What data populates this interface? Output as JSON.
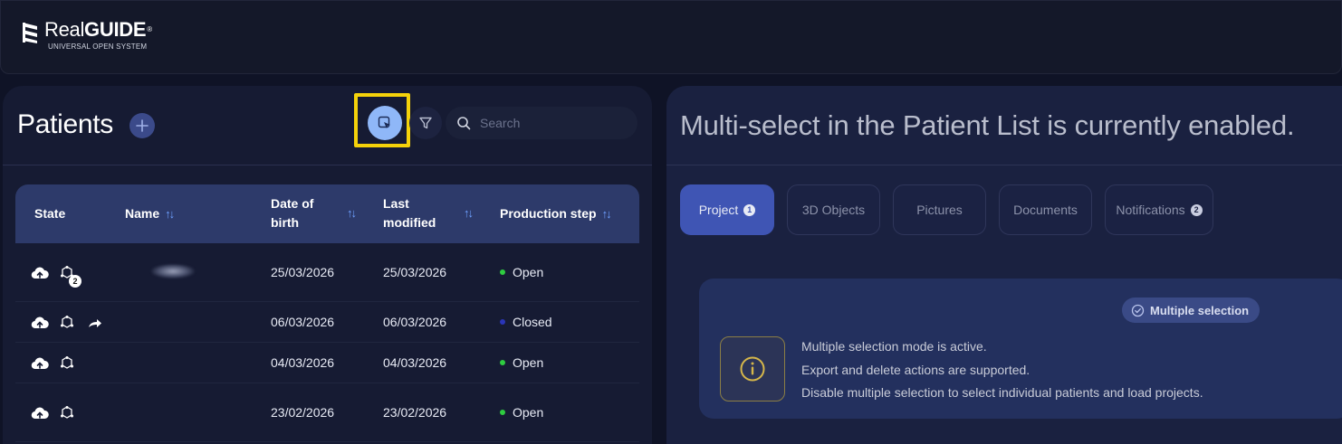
{
  "app": {
    "logo_title_regular": "Real",
    "logo_title_bold": "GUIDE",
    "logo_reg": "®",
    "logo_subtitle": "UNIVERSAL OPEN SYSTEM"
  },
  "patients_panel": {
    "title": "Patients",
    "search_placeholder": "Search",
    "columns": [
      {
        "label": "State"
      },
      {
        "label": "Name",
        "sortable": true
      },
      {
        "label_line1": "Date of",
        "label_line2": "birth",
        "sortable": true
      },
      {
        "label_line1": "Last",
        "label_line2": "modified",
        "sortable": true
      },
      {
        "label": "Production step",
        "sortable": true
      }
    ],
    "rows": [
      {
        "dob": "25/03/2026",
        "modified": "25/03/2026",
        "step": "Open",
        "status_color": "#2ecc40",
        "badge": "2",
        "share": false
      },
      {
        "dob": "06/03/2026",
        "modified": "06/03/2026",
        "step": "Closed",
        "status_color": "#2a35b8",
        "badge": "",
        "share": true
      },
      {
        "dob": "04/03/2026",
        "modified": "04/03/2026",
        "step": "Open",
        "status_color": "#2ecc40",
        "badge": "",
        "share": false
      },
      {
        "dob": "23/02/2026",
        "modified": "23/02/2026",
        "step": "Open",
        "status_color": "#2ecc40",
        "badge": "",
        "share": false
      }
    ]
  },
  "detail_panel": {
    "title": "Multi-select in the Patient List is currently enabled.",
    "tabs": [
      {
        "label": "Project",
        "count": "1",
        "active": true
      },
      {
        "label": "3D Objects",
        "count": "",
        "active": false
      },
      {
        "label": "Pictures",
        "count": "",
        "active": false
      },
      {
        "label": "Documents",
        "count": "",
        "active": false
      },
      {
        "label": "Notifications",
        "count": "2",
        "active": false
      }
    ],
    "pill_label": "Multiple selection",
    "info_lines": [
      "Multiple selection mode is active.",
      "Export and delete actions are supported.",
      "Disable multiple selection to select individual patients and load projects."
    ]
  },
  "colors": {
    "accent": "#3f55b4",
    "highlight": "#f5d20a",
    "open": "#2ecc40",
    "closed": "#2a35b8"
  }
}
